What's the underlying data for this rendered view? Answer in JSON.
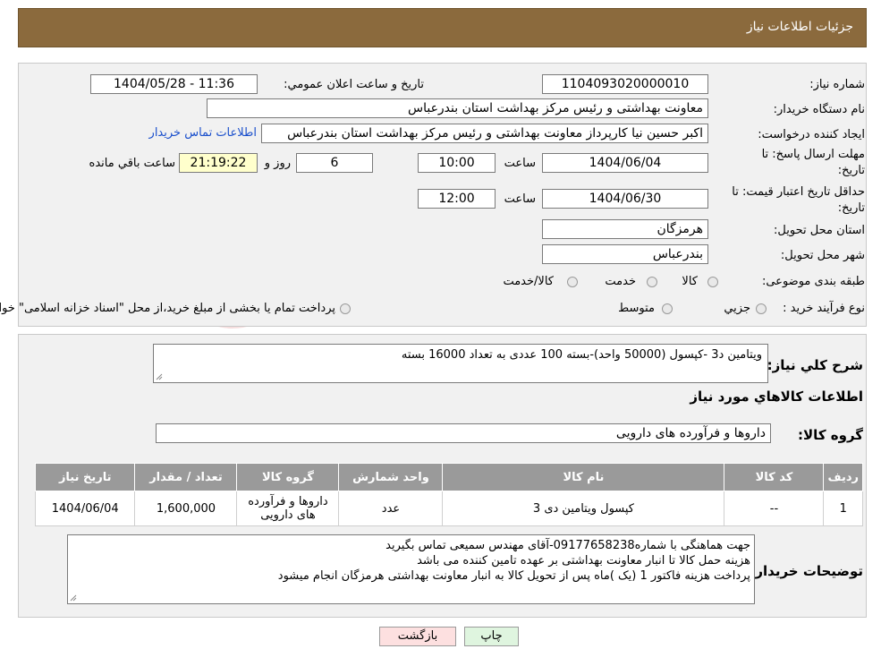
{
  "header": {
    "title": "جزئیات اطلاعات نیاز"
  },
  "form": {
    "need_number_label": "شماره نیاز:",
    "need_number": "1104093020000010",
    "announce_label": "تاریخ و ساعت اعلان عمومي:",
    "announce_value": "1404/05/28 - 11:36",
    "buyer_label": "نام دستگاه خريدار:",
    "buyer_value": "معاونت  بهداشتی و رئیس مرکز بهداشت استان بندرعباس",
    "creator_label": "ايجاد کننده درخواست:",
    "creator_value": "اکبر حسین نیا کارپرداز معاونت  بهداشتی و رئیس مرکز بهداشت استان بندرعباس",
    "contact_link": "اطلاعات تماس خريدار",
    "deadline_label_1": "مهلت ارسال پاسخ: تا",
    "deadline_label_2": "تاريخ:",
    "deadline_date": "1404/06/04",
    "time_label": "ساعت",
    "deadline_time": "10:00",
    "days_value": "6",
    "days_label": "روز و",
    "remaining_value": "21:19:22",
    "remaining_label": "ساعت باقي مانده",
    "validity_label_1": "حداقل تاريخ اعتبار قيمت: تا",
    "validity_label_2": "تاريخ:",
    "validity_date": "1404/06/30",
    "validity_time": "12:00",
    "province_label": "استان محل تحويل:",
    "province_value": "هرمزگان",
    "city_label": "شهر محل تحويل:",
    "city_value": "بندرعباس",
    "category_label": "طبقه بندی موضوعی:",
    "category_options": [
      "کالا",
      "خدمت",
      "کالا/خدمت"
    ],
    "process_label": "نوع فرآيند خريد :",
    "process_options": [
      "جزيي",
      "متوسط"
    ],
    "process_note": "پرداخت تمام يا بخشی از مبلغ خريد،از محل \"اسناد خزانه اسلامی\" خواهد بود."
  },
  "details": {
    "summary_label": "شرح كلي نياز:",
    "summary_value": "ویتامین د3 -کپسول (50000 واحد)-بسته 100 عددی به تعداد 16000 بسته",
    "goods_info_title": "اطلاعات كالاهاي مورد نياز",
    "group_label": "گروه كالا:",
    "group_value": "داروها و فرآورده های دارویی",
    "table": {
      "headers": [
        "رديف",
        "كد كالا",
        "نام كالا",
        "واحد شمارش",
        "گروه كالا",
        "تعداد / مقدار",
        "تاريخ نياز"
      ],
      "rows": [
        [
          "1",
          "--",
          "کپسول ویتامین دی 3",
          "عدد",
          "داروها و فرآورده های دارویی",
          "1,600,000",
          "1404/06/04"
        ]
      ]
    },
    "notes_label": "توضيحات خريدار:",
    "notes_lines": [
      "جهت هماهنگی با شماره09177658238-آقای مهندس سمیعی تماس بگیرید",
      "هزینه حمل کالا تا انبار  معاونت بهداشتی بر عهده تامین کننده می باشد",
      "پرداخت هزینه فاکتور 1 (یک )ماه  پس از تحویل کالا به انبار معاونت بهداشتی هرمزگان انجام میشود"
    ]
  },
  "buttons": {
    "print": "چاپ",
    "back": "بازگشت"
  },
  "watermark": {
    "text": "AriaTender.neT"
  },
  "colors": {
    "header": "#8b6a3d",
    "panel": "#f1f1f1",
    "table_header": "#9a9a9a",
    "link": "#1a4fcc",
    "remaining_bg": "#ffffcc"
  }
}
